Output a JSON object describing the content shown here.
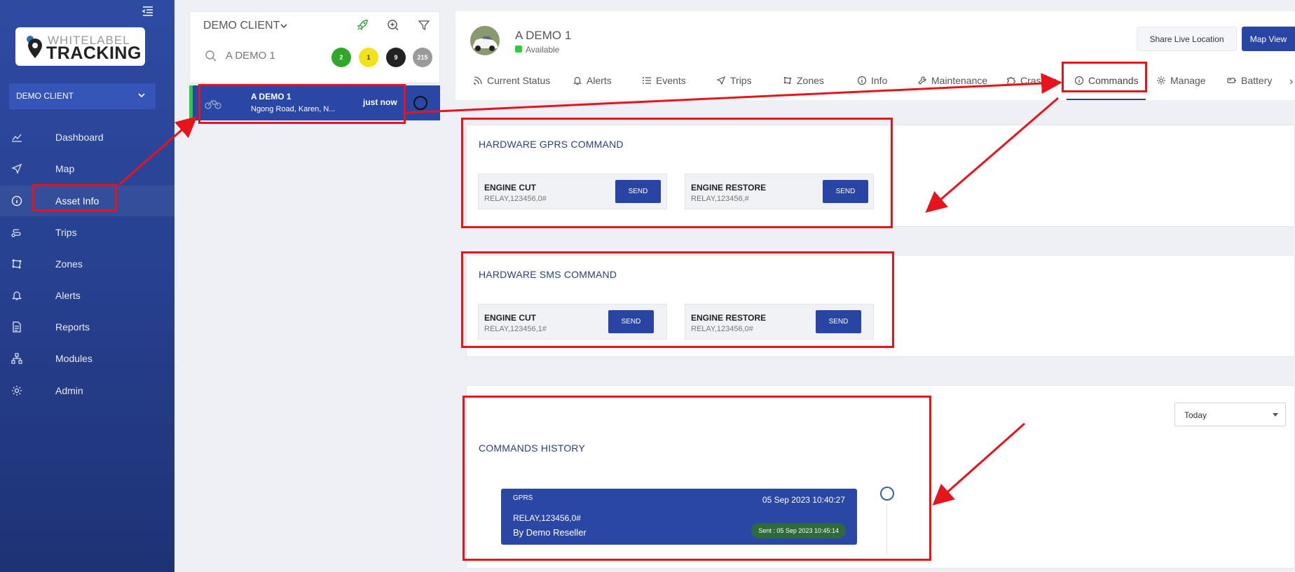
{
  "sidebar": {
    "logo_top": "WHITELABEL",
    "logo_bottom": "TRACKING",
    "client": "DEMO CLIENT",
    "items": [
      {
        "label": "Dashboard"
      },
      {
        "label": "Map"
      },
      {
        "label": "Asset Info"
      },
      {
        "label": "Trips"
      },
      {
        "label": "Zones"
      },
      {
        "label": "Alerts"
      },
      {
        "label": "Reports"
      },
      {
        "label": "Modules"
      },
      {
        "label": "Admin"
      }
    ]
  },
  "list": {
    "client": "DEMO CLIENT",
    "search_value": "A DEMO 1",
    "badges": [
      {
        "count": "2",
        "color": "#2fa82a"
      },
      {
        "count": "1",
        "color": "#f2e21b"
      },
      {
        "count": "9",
        "color": "#222222"
      },
      {
        "count": "215",
        "color": "#9a9a9a"
      }
    ],
    "asset": {
      "name": "A DEMO 1",
      "address": "Ngong Road, Karen, N...",
      "time": "just now"
    }
  },
  "detail": {
    "name": "A DEMO 1",
    "status": "Available",
    "share_label": "Share Live Location",
    "mapview_label": "Map View",
    "tabs": [
      {
        "label": "Current Status",
        "icon": "rss-icon"
      },
      {
        "label": "Alerts",
        "icon": "bell-icon"
      },
      {
        "label": "Events",
        "icon": "list-icon"
      },
      {
        "label": "Trips",
        "icon": "navigation-icon"
      },
      {
        "label": "Zones",
        "icon": "zone-icon"
      },
      {
        "label": "Info",
        "icon": "info-icon"
      },
      {
        "label": "Maintenance",
        "icon": "wrench-icon"
      },
      {
        "label": "Crashes",
        "icon": "puzzle-icon"
      },
      {
        "label": "Commands",
        "icon": "info-icon"
      },
      {
        "label": "Manage",
        "icon": "gear-icon"
      },
      {
        "label": "Battery",
        "icon": "battery-icon"
      }
    ],
    "tab_more": "›"
  },
  "gprs": {
    "title": "HARDWARE GPRS COMMAND",
    "commands": [
      {
        "title": "ENGINE CUT",
        "code": "RELAY,123456,0#",
        "send": "SEND"
      },
      {
        "title": "ENGINE RESTORE",
        "code": "RELAY,123456,#",
        "send": "SEND"
      }
    ]
  },
  "sms": {
    "title": "HARDWARE SMS COMMAND",
    "commands": [
      {
        "title": "ENGINE CUT",
        "code": "RELAY,123456,1#",
        "send": "SEND"
      },
      {
        "title": "ENGINE RESTORE",
        "code": "RELAY,123456,0#",
        "send": "SEND"
      }
    ]
  },
  "history": {
    "title": "COMMANDS HISTORY",
    "filter": "Today",
    "item": {
      "type": "GPRS",
      "date": "05 Sep 2023 10:40:27",
      "command": "RELAY,123456,0#",
      "by": "By Demo Reseller",
      "sent": "Sent : 05 Sep 2023 10:45:14"
    }
  },
  "colors": {
    "accent": "#2845a3",
    "annotation": "#e8141c",
    "available": "#2ecc40"
  }
}
